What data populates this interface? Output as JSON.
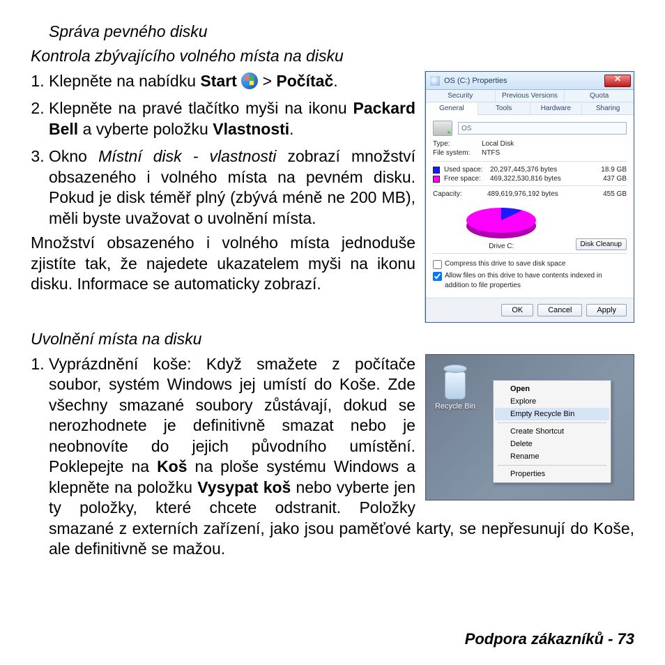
{
  "headings": {
    "h1": "Správa pevného disku",
    "h2a": "Kontrola zbývajícího volného místa na disku",
    "h2b": "Uvolnění místa na disku"
  },
  "steps_a": {
    "s1_pre": "Klepněte na nabídku ",
    "s1_start": "Start",
    "s1_gt": " > ",
    "s1_pocitac": "Počítač",
    "s1_dot": ".",
    "s2_a": "Klepněte na pravé tlačítko myši na ikonu ",
    "s2_b": "Packard Bell",
    "s2_c": " a vyberte položku ",
    "s2_d": "Vlastnosti",
    "s2_e": ".",
    "s3_a": "Okno ",
    "s3_b": "Místní disk - vlastnosti",
    "s3_c": " zobrazí množství obsazeného i volného místa na pevném disku. Pokud je disk téměř plný (zbývá méně ne 200 MB), měli byste uvažovat o uvolnění místa."
  },
  "para_a": "Množství obsazeného i volného místa jednoduše zjistíte tak, že najedete ukazatelem myši na ikonu disku. Informace se automaticky zobrazí.",
  "steps_b": {
    "s1_a": "Vyprázdnění koše: Když smažete z počítače soubor, systém Windows jej umístí do Koše. Zde všechny smazané soubory zůstávají, dokud se nerozhodnete je definitivně smazat nebo je neobnovíte do jejich původního umístění. Poklepejte na ",
    "s1_b": "Koš",
    "s1_c": " na ploše systému Windows a klepněte na položku ",
    "s1_d": "Vysypat koš",
    "s1_e": " nebo vyberte jen ty položky, které chcete odstranit. Položky smazané z externích zařízení, jako jsou paměťové karty, se nepřesunují do Koše, ale definitivně se mažou."
  },
  "footer": {
    "label": "Podpora zákazníků -  ",
    "page": "73"
  },
  "propwin": {
    "title": "OS (C:) Properties",
    "tabs_top": [
      "Security",
      "Previous Versions",
      "Quota"
    ],
    "tabs_bottom": [
      "General",
      "Tools",
      "Hardware",
      "Sharing"
    ],
    "drive_label": "OS",
    "type_k": "Type:",
    "type_v": "Local Disk",
    "fs_k": "File system:",
    "fs_v": "NTFS",
    "used_k": "Used space:",
    "used_bytes": "20,297,445,376 bytes",
    "used_gb": "18.9 GB",
    "free_k": "Free space:",
    "free_bytes": "469,322,530,816 bytes",
    "free_gb": "437 GB",
    "cap_k": "Capacity:",
    "cap_bytes": "489,619,976,192 bytes",
    "cap_gb": "455 GB",
    "drive_c": "Drive C:",
    "cleanup": "Disk Cleanup",
    "chk1": "Compress this drive to save disk space",
    "chk2": "Allow files on this drive to have contents indexed in addition to file properties",
    "ok": "OK",
    "cancel": "Cancel",
    "apply": "Apply"
  },
  "rcwin": {
    "label": "Recycle Bin",
    "menu": {
      "open": "Open",
      "explore": "Explore",
      "empty": "Empty Recycle Bin",
      "shortcut": "Create Shortcut",
      "delete": "Delete",
      "rename": "Rename",
      "props": "Properties"
    }
  },
  "chart_data": {
    "type": "pie",
    "title": "Drive C:",
    "series": [
      {
        "name": "Used space",
        "value_bytes": 20297445376,
        "value_gb": 18.9,
        "color": "#1a1aff"
      },
      {
        "name": "Free space",
        "value_bytes": 469322530816,
        "value_gb": 437,
        "color": "#ff00ff"
      }
    ],
    "total_bytes": 489619976192,
    "total_gb": 455
  }
}
